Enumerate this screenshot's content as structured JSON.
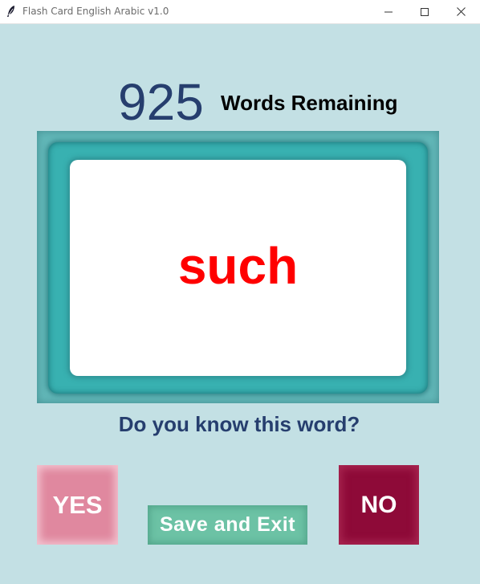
{
  "window": {
    "title": "Flash Card English Arabic v1.0",
    "controls": [
      "minimize-icon",
      "maximize-icon",
      "close-icon"
    ]
  },
  "status": {
    "count": "925",
    "count_label": "Words Remaining"
  },
  "card": {
    "word": "such",
    "word_color": "#ff0000"
  },
  "prompt": {
    "question": "Do you know this word?"
  },
  "buttons": {
    "yes_label": "YES",
    "no_label": "NO",
    "save_label": "Save and Exit"
  },
  "colors": {
    "background": "#c3e0e4",
    "card_frame": "#38b1b1",
    "yes_button": "#e0889f",
    "no_button": "#8e0a38",
    "save_button": "#6cc2a5",
    "heading_text": "#263e6e"
  }
}
